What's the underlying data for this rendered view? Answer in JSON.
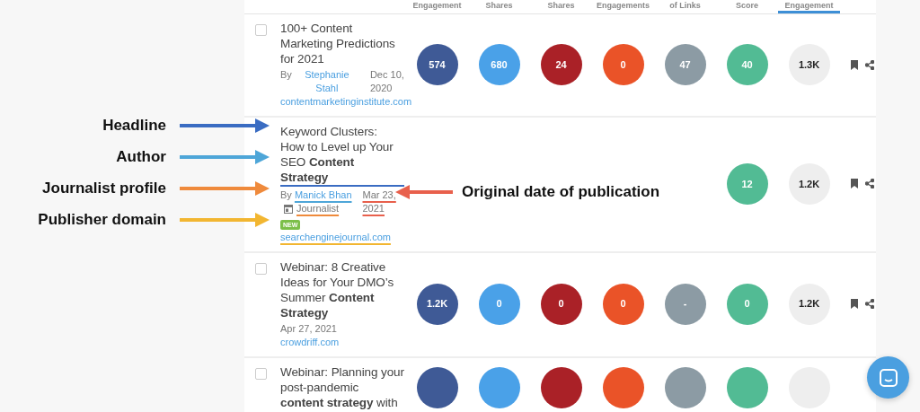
{
  "header": {
    "columns": [
      {
        "label": "Engagement",
        "selected": false
      },
      {
        "label": "Shares",
        "selected": false
      },
      {
        "label": "Shares",
        "selected": false
      },
      {
        "label": "Engagements",
        "selected": false
      },
      {
        "label": "of Links",
        "selected": false
      },
      {
        "label": "Score",
        "selected": false
      },
      {
        "label": "Engagement",
        "selected": true
      }
    ]
  },
  "rows": [
    {
      "checked": false,
      "title": "100+ Content Marketing Predictions for 2021",
      "author_prefix": "By",
      "author": "Stephanie Stahl",
      "date": "Dec 10, 2020",
      "domain": "contentmarketinginstitute.com",
      "metrics": [
        {
          "kind": "count",
          "value": "574",
          "color": "#3f5a96"
        },
        {
          "kind": "count",
          "value": "680",
          "color": "#4aa1e8"
        },
        {
          "kind": "count",
          "value": "24",
          "color": "#aa2127"
        },
        {
          "kind": "count",
          "value": "0",
          "color": "#ea5328"
        },
        {
          "kind": "count",
          "value": "47",
          "color": "#8c9ba4"
        },
        {
          "kind": "count",
          "value": "40",
          "color": "#52bb94"
        },
        {
          "kind": "total",
          "value": "1.3K",
          "color": "#eeeeee"
        }
      ]
    },
    {
      "annotated": true,
      "title": "Keyword Clusters: How to Level up Your SEO **Content Strategy**",
      "author_prefix": "By",
      "author": "Manick Bhan",
      "profile": "Journalist",
      "badge": "NEW",
      "date": "Mar 23, 2021",
      "domain": "searchenginejournal.com",
      "metrics": [
        {
          "kind": "empty"
        },
        {
          "kind": "empty"
        },
        {
          "kind": "empty"
        },
        {
          "kind": "empty"
        },
        {
          "kind": "empty"
        },
        {
          "kind": "count",
          "value": "12",
          "color": "#52bb94"
        },
        {
          "kind": "total",
          "value": "1.2K",
          "color": "#eeeeee"
        }
      ]
    },
    {
      "checked": false,
      "title": "Webinar: 8 Creative Ideas for Your DMO’s Summer **Content Strategy**",
      "date": "Apr 27, 2021",
      "domain": "crowdriff.com",
      "metrics": [
        {
          "kind": "count",
          "value": "1.2K",
          "color": "#3f5a96"
        },
        {
          "kind": "count",
          "value": "0",
          "color": "#4aa1e8"
        },
        {
          "kind": "count",
          "value": "0",
          "color": "#aa2127"
        },
        {
          "kind": "count",
          "value": "0",
          "color": "#ea5328"
        },
        {
          "kind": "count",
          "value": "-",
          "color": "#8c9ba4"
        },
        {
          "kind": "count",
          "value": "0",
          "color": "#52bb94"
        },
        {
          "kind": "total",
          "value": "1.2K",
          "color": "#eeeeee"
        }
      ]
    },
    {
      "checked": false,
      "title": "Webinar: Planning your post-pandemic **content strategy** with",
      "metrics": [
        {
          "kind": "count",
          "color": "#3f5a96"
        },
        {
          "kind": "count",
          "color": "#4aa1e8"
        },
        {
          "kind": "count",
          "color": "#aa2127"
        },
        {
          "kind": "count",
          "color": "#ea5328"
        },
        {
          "kind": "count",
          "color": "#8c9ba4"
        },
        {
          "kind": "count",
          "color": "#52bb94"
        },
        {
          "kind": "total",
          "color": "#eeeeee"
        }
      ]
    }
  ],
  "annotations": [
    {
      "kind": "left",
      "label": "Headline",
      "color": "#3a6cc2"
    },
    {
      "kind": "left",
      "label": "Author",
      "color": "#4ea6d8"
    },
    {
      "kind": "left",
      "label": "Journalist profile",
      "color": "#ef8a3c"
    },
    {
      "kind": "left",
      "label": "Publisher domain",
      "color": "#f2b631"
    },
    {
      "kind": "right",
      "label": "Original date of publication",
      "color": "#e8604c"
    }
  ]
}
